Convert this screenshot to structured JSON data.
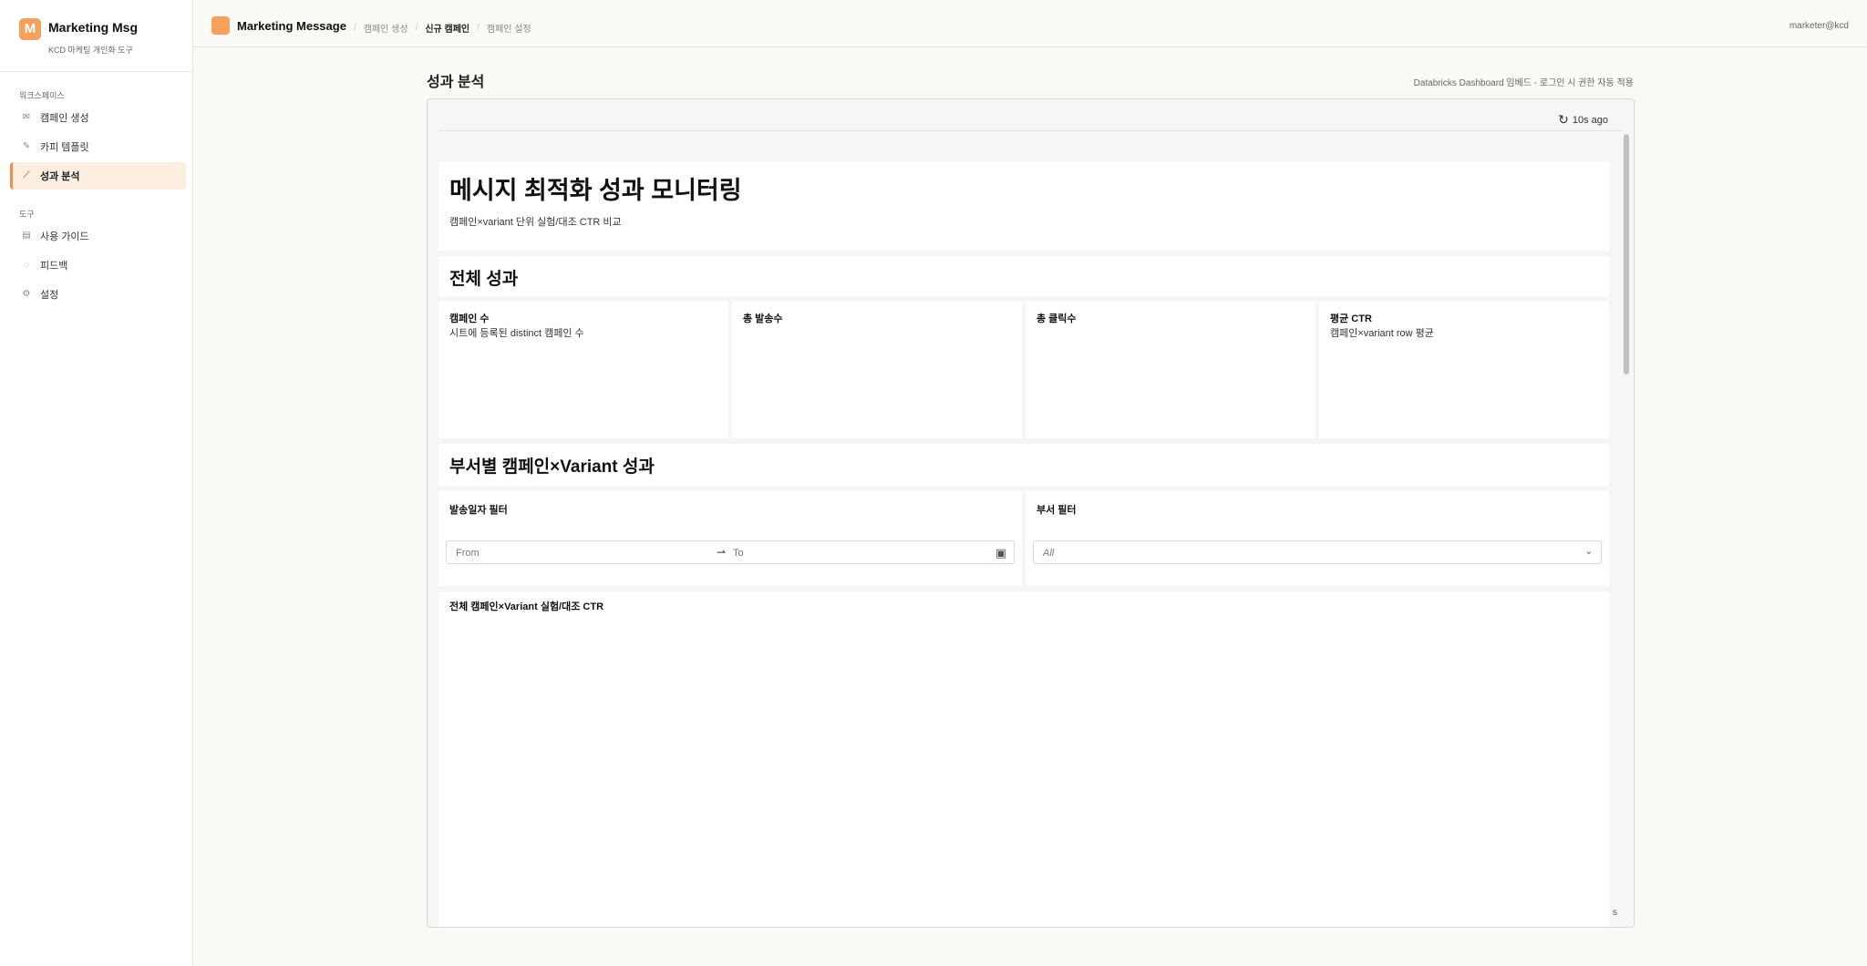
{
  "sidebar": {
    "brand_letter": "M",
    "brand_name": "Marketing Msg",
    "brand_sub": "KCD 마케팅 개인화 도구",
    "section_workspace": "워크스페이스",
    "section_tools": "도구",
    "workspace_items": [
      {
        "label": "캠페인 생성",
        "icon": "envelope-icon"
      },
      {
        "label": "카피 템플릿",
        "icon": "memo-icon"
      },
      {
        "label": "성과 분석",
        "icon": "chart-icon"
      }
    ],
    "tool_items": [
      {
        "label": "사용 가이드",
        "icon": "book-icon"
      },
      {
        "label": "피드백",
        "icon": "speech-bubble-icon"
      },
      {
        "label": "설정",
        "icon": "gear-icon"
      }
    ]
  },
  "topbar": {
    "title": "Marketing Message",
    "crumbs": [
      "캠페인 생성",
      "신규 캠페인",
      "캠페인 설정"
    ],
    "user": "marketer@kcd"
  },
  "main": {
    "title": "성과 분석",
    "embed_note": "Databricks Dashboard 임베드 - 로그인 시 권한 자동 적용"
  },
  "dashboard": {
    "refresh": "10s ago",
    "title": "메시지 최적화 성과 모니터링",
    "subtitle": "캠페인×variant 단위 실험/대조 CTR 비교",
    "section_overall": "전체 성과",
    "kpis": [
      {
        "label": "캠페인 수",
        "desc": "시트에 등록된 distinct 캠페인 수"
      },
      {
        "label": "총 발송수",
        "desc": ""
      },
      {
        "label": "총 클릭수",
        "desc": ""
      },
      {
        "label": "평균 CTR",
        "desc": "캠페인×variant row 평균"
      }
    ],
    "section_dept": "부서별 캠페인×Variant 성과",
    "date_filter": {
      "label": "발송일자 필터",
      "from": "From",
      "to": "To"
    },
    "dept_filter": {
      "label": "부서 필터",
      "value": "All"
    },
    "table_title": "전체 캠페인×Variant 실험/대조 CTR",
    "corner_text": "s"
  },
  "colors": {
    "accent": "#f5a05c",
    "active_bg": "#fdeee2"
  }
}
